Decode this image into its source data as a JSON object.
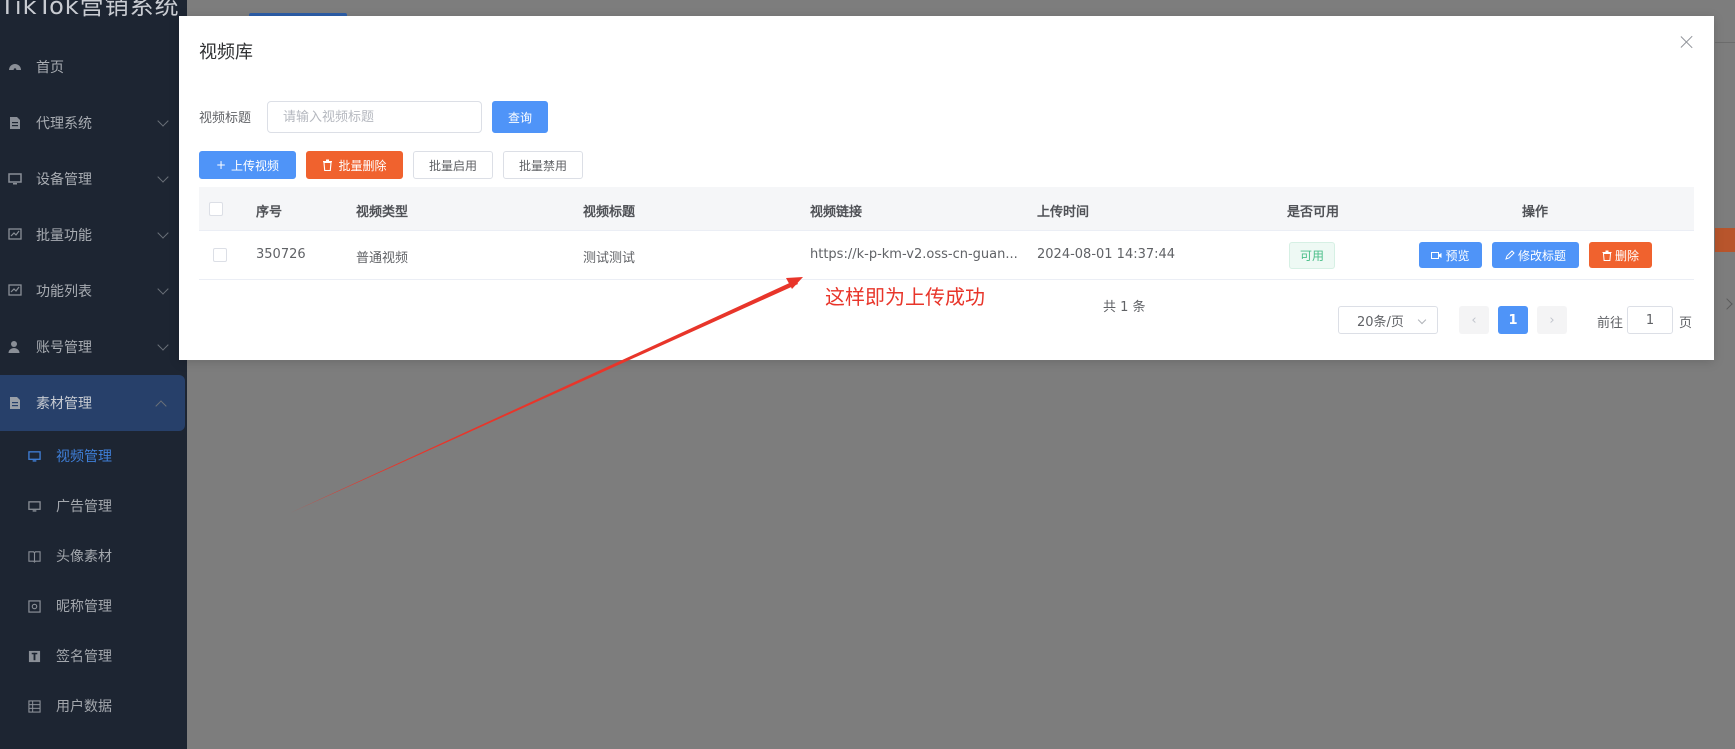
{
  "app": {
    "brand": "TikTok营销系统"
  },
  "sidebar": {
    "items": [
      {
        "label": "首页",
        "icon": "dashboard-icon",
        "expandable": false
      },
      {
        "label": "代理系统",
        "icon": "document-icon",
        "expandable": true
      },
      {
        "label": "设备管理",
        "icon": "monitor-icon",
        "expandable": true
      },
      {
        "label": "批量功能",
        "icon": "chart-icon",
        "expandable": true
      },
      {
        "label": "功能列表",
        "icon": "chart-icon",
        "expandable": true
      },
      {
        "label": "账号管理",
        "icon": "user-icon",
        "expandable": true
      },
      {
        "label": "素材管理",
        "icon": "document-icon",
        "expandable": true,
        "active": true
      }
    ],
    "subitems": [
      {
        "label": "视频管理",
        "icon": "monitor-icon",
        "current": true
      },
      {
        "label": "广告管理",
        "icon": "monitor-icon"
      },
      {
        "label": "头像素材",
        "icon": "book-icon"
      },
      {
        "label": "昵称管理",
        "icon": "image-icon"
      },
      {
        "label": "签名管理",
        "icon": "text-icon"
      },
      {
        "label": "用户数据",
        "icon": "grid-icon"
      }
    ]
  },
  "dialog": {
    "title": "视频库",
    "search": {
      "label": "视频标题",
      "placeholder": "请输入视频标题",
      "value": "",
      "button": "查询"
    },
    "toolbar": {
      "upload": "上传视频",
      "batch_delete": "批量删除",
      "batch_enable": "批量启用",
      "batch_disable": "批量禁用"
    },
    "table": {
      "columns": [
        "序号",
        "视频类型",
        "视频标题",
        "视频链接",
        "上传时间",
        "是否可用",
        "操作"
      ],
      "rows": [
        {
          "id": "350726",
          "type": "普通视频",
          "title": "测试测试",
          "link": "https://k-p-km-v2.oss-cn-guan...",
          "time": "2024-08-01 14:37:44",
          "status": "可用",
          "actions": {
            "preview": "预览",
            "edit": "修改标题",
            "delete": "删除"
          }
        }
      ]
    },
    "pagination": {
      "total": "共 1 条",
      "page_size": "20条/页",
      "current": "1",
      "goto_label": "前往",
      "goto_value": "1",
      "page_suffix": "页"
    }
  },
  "annotation": {
    "text": "这样即为上传成功",
    "color": "#e8352a"
  },
  "colors": {
    "primary": "#4f94f8",
    "danger": "#f0622e",
    "success": "#4cbf8a",
    "sidebar": "#1d2532"
  }
}
